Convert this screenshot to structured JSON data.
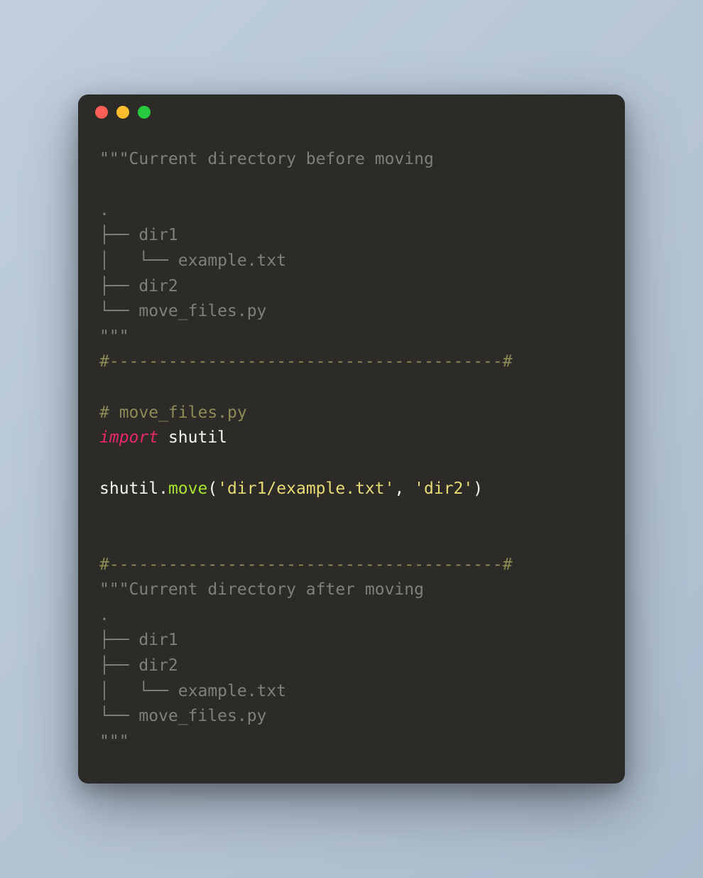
{
  "code": {
    "docstring1_open": "\"\"\"",
    "docstring1_title": "Current directory before moving",
    "tree1_line1": ".",
    "tree1_line2": "├── dir1",
    "tree1_line3": "│   └── example.txt",
    "tree1_line4": "├── dir2",
    "tree1_line5": "└── move_files.py",
    "docstring1_close": "\"\"\"",
    "separator1": "#----------------------------------------#",
    "comment_file": "# move_files.py",
    "import_keyword": "import",
    "import_module": " shutil",
    "call_object": "shutil",
    "call_dot": ".",
    "call_method": "move",
    "call_paren_open": "(",
    "call_arg1": "'dir1/example.txt'",
    "call_comma": ", ",
    "call_arg2": "'dir2'",
    "call_paren_close": ")",
    "separator2": "#----------------------------------------#",
    "docstring2_open": "\"\"\"",
    "docstring2_title": "Current directory after moving",
    "tree2_line1": ".",
    "tree2_line2": "├── dir1",
    "tree2_line3": "├── dir2",
    "tree2_line4": "│   └── example.txt",
    "tree2_line5": "└── move_files.py",
    "docstring2_close": "\"\"\""
  },
  "colors": {
    "window_bg": "#2d2b28",
    "traffic_red": "#ff5f56",
    "traffic_yellow": "#ffbd2e",
    "traffic_green": "#27c93f",
    "docstring": "#7f7f7b",
    "comment": "#8b8b56",
    "keyword": "#e6296a",
    "default": "#f8f8f2",
    "method": "#a6e22e",
    "string": "#e6db74"
  }
}
